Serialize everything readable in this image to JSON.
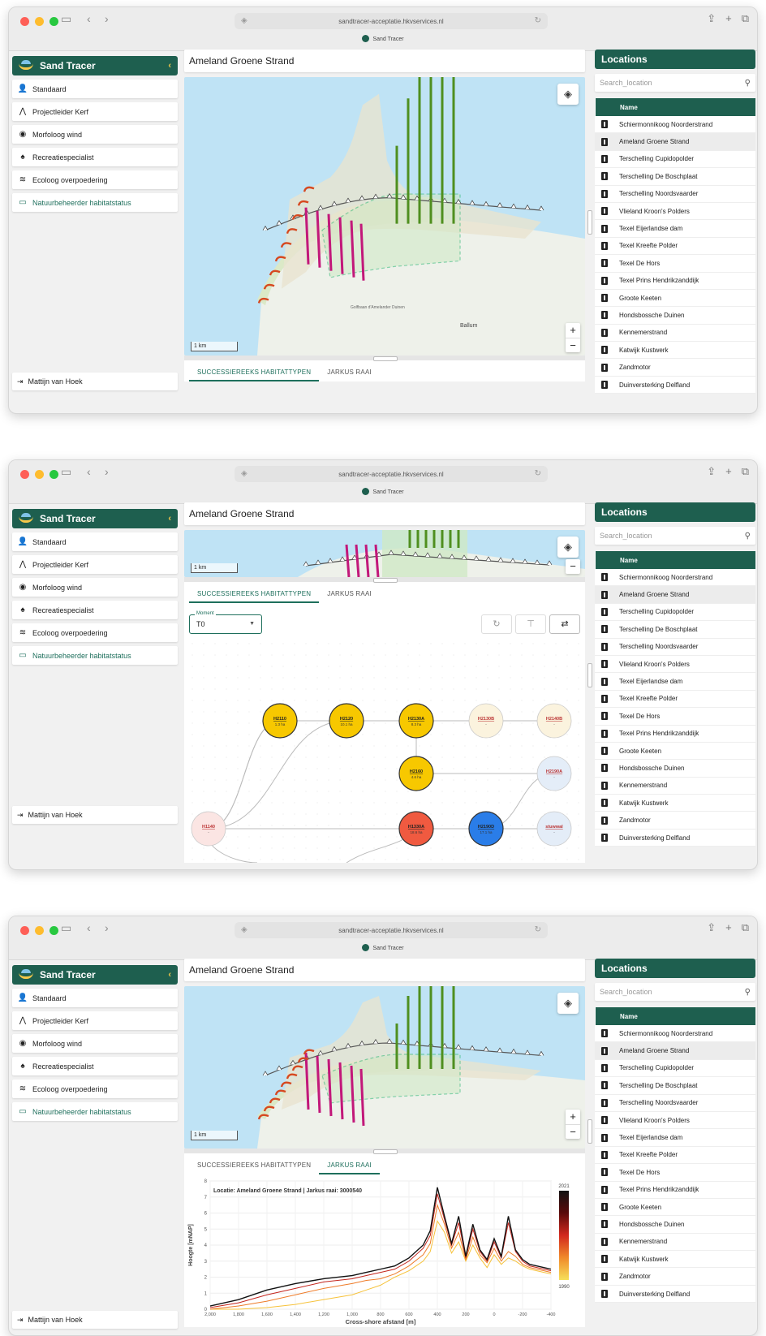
{
  "browser": {
    "url": "sandtracer-acceptatie.hkvservices.nl",
    "tab_title": "Sand Tracer"
  },
  "app": {
    "name": "Sand Tracer",
    "page_title": "Ameland Groene Strand",
    "user": "Mattijn van Hoek"
  },
  "sidebar": {
    "items": [
      {
        "label": "Standaard",
        "icon": "person-icon"
      },
      {
        "label": "Projectleider Kerf",
        "icon": "walking-icon"
      },
      {
        "label": "Morfoloog wind",
        "icon": "location-pin-icon"
      },
      {
        "label": "Recreatiespecialist",
        "icon": "tree-icon"
      },
      {
        "label": "Ecoloog overpoedering",
        "icon": "wind-icon"
      },
      {
        "label": "Natuurbeheerder habitatstatus",
        "icon": "display-icon"
      }
    ],
    "active_index": 5
  },
  "map": {
    "scale_label": "1 km",
    "zoom_in": "+",
    "zoom_out": "−",
    "place_labels": [
      "Ballum",
      "Golfbaan d'Amelander Duinen"
    ]
  },
  "tabs": {
    "habitat": "SUCCESSIEREEKS HABITATTYPEN",
    "jarkus": "JARKUS RAAI"
  },
  "graph": {
    "moment_label": "Moment",
    "moment_value": "T0",
    "nodes": [
      {
        "code": "H2110",
        "area": "1.3 ha",
        "color": "#f7c800"
      },
      {
        "code": "H2120",
        "area": "10.1 ha",
        "color": "#f7c800"
      },
      {
        "code": "H2130A",
        "area": "8.3 ha",
        "color": "#f7c800"
      },
      {
        "code": "H2130B",
        "area": "-",
        "color": "#fbf3de"
      },
      {
        "code": "H2140B",
        "area": "-",
        "color": "#fbf3de"
      },
      {
        "code": "H2160",
        "area": "4.6 ha",
        "color": "#f7c800"
      },
      {
        "code": "H2190A",
        "area": "-",
        "color": "#e4edf8"
      },
      {
        "code": "H1140",
        "area": "-",
        "color": "#fbe5e3"
      },
      {
        "code": "H1330A",
        "area": "18.6 ha",
        "color": "#f05a40"
      },
      {
        "code": "H2190D",
        "area": "17.1 ha",
        "color": "#2a7de8"
      },
      {
        "code": "stuwwal",
        "area": "-",
        "color": "#e4edf8"
      }
    ]
  },
  "locations": {
    "title": "Locations",
    "search_placeholder": "Search_location",
    "column_name": "Name",
    "selected_index": 1,
    "rows": [
      "Schiermonnikoog Noorderstrand",
      "Ameland Groene Strand",
      "Terschelling Cupidopolder",
      "Terschelling De Boschplaat",
      "Terschelling Noordsvaarder",
      "Vlieland Kroon's Polders",
      "Texel Eijerlandse dam",
      "Texel Kreefte Polder",
      "Texel De Hors",
      "Texel Prins Hendrikzanddijk",
      "Groote Keeten",
      "Hondsbossche Duinen",
      "Kennemerstrand",
      "Katwijk Kustwerk",
      "Zandmotor",
      "Duinversterking Delfland"
    ]
  },
  "chart_data": {
    "type": "line",
    "title": "Locatie: Ameland Groene Strand | Jarkus raai: 3000540",
    "xlabel": "Cross-shore afstand [m]",
    "ylabel": "Hoogte [mNAP]",
    "xlim": [
      2000,
      -400
    ],
    "ylim": [
      0,
      8
    ],
    "x_ticks": [
      2000,
      1800,
      1600,
      1400,
      1200,
      1000,
      800,
      600,
      400,
      200,
      0,
      -200,
      -400
    ],
    "y_ticks": [
      0,
      1,
      2,
      3,
      4,
      5,
      6,
      7,
      8
    ],
    "colorbar": {
      "min_label": "1990",
      "max_label": "2021",
      "colors": [
        "#f6e05a",
        "#f08a2a",
        "#d2281e",
        "#5a0a0a",
        "#111111"
      ]
    },
    "x": [
      2000,
      1800,
      1600,
      1400,
      1200,
      1000,
      900,
      800,
      700,
      600,
      500,
      450,
      400,
      350,
      300,
      250,
      200,
      150,
      100,
      50,
      0,
      -50,
      -100,
      -150,
      -200,
      -250,
      -300,
      -350,
      -400
    ],
    "series": [
      {
        "values": [
          0.0,
          0.0,
          0.1,
          0.3,
          0.6,
          0.9,
          1.2,
          1.5,
          2.0,
          2.4,
          3.0,
          3.6,
          5.5,
          4.8,
          3.5,
          4.2,
          3.0,
          4.0,
          3.2,
          2.6,
          3.4,
          2.8,
          3.2,
          3.0,
          2.7,
          2.5,
          2.4,
          2.3,
          2.2
        ]
      },
      {
        "values": [
          0.0,
          0.2,
          0.5,
          0.9,
          1.3,
          1.6,
          1.8,
          1.9,
          2.2,
          2.7,
          3.4,
          4.1,
          6.5,
          5.3,
          3.8,
          4.8,
          3.1,
          4.5,
          3.4,
          2.9,
          3.8,
          3.0,
          3.6,
          3.3,
          2.8,
          2.6,
          2.5,
          2.4,
          2.3
        ]
      },
      {
        "values": [
          0.1,
          0.4,
          0.9,
          1.3,
          1.7,
          1.9,
          2.1,
          2.3,
          2.5,
          3.0,
          3.8,
          4.6,
          7.2,
          5.6,
          4.0,
          5.4,
          3.2,
          5.0,
          3.6,
          3.0,
          4.2,
          3.2,
          5.4,
          3.6,
          3.0,
          2.7,
          2.6,
          2.5,
          2.4
        ]
      },
      {
        "values": [
          0.2,
          0.6,
          1.2,
          1.6,
          1.9,
          2.1,
          2.3,
          2.5,
          2.7,
          3.2,
          4.0,
          4.9,
          7.6,
          5.8,
          4.1,
          5.8,
          3.3,
          5.3,
          3.7,
          3.1,
          4.4,
          3.3,
          5.8,
          3.7,
          3.1,
          2.8,
          2.7,
          2.6,
          2.5
        ]
      }
    ]
  }
}
